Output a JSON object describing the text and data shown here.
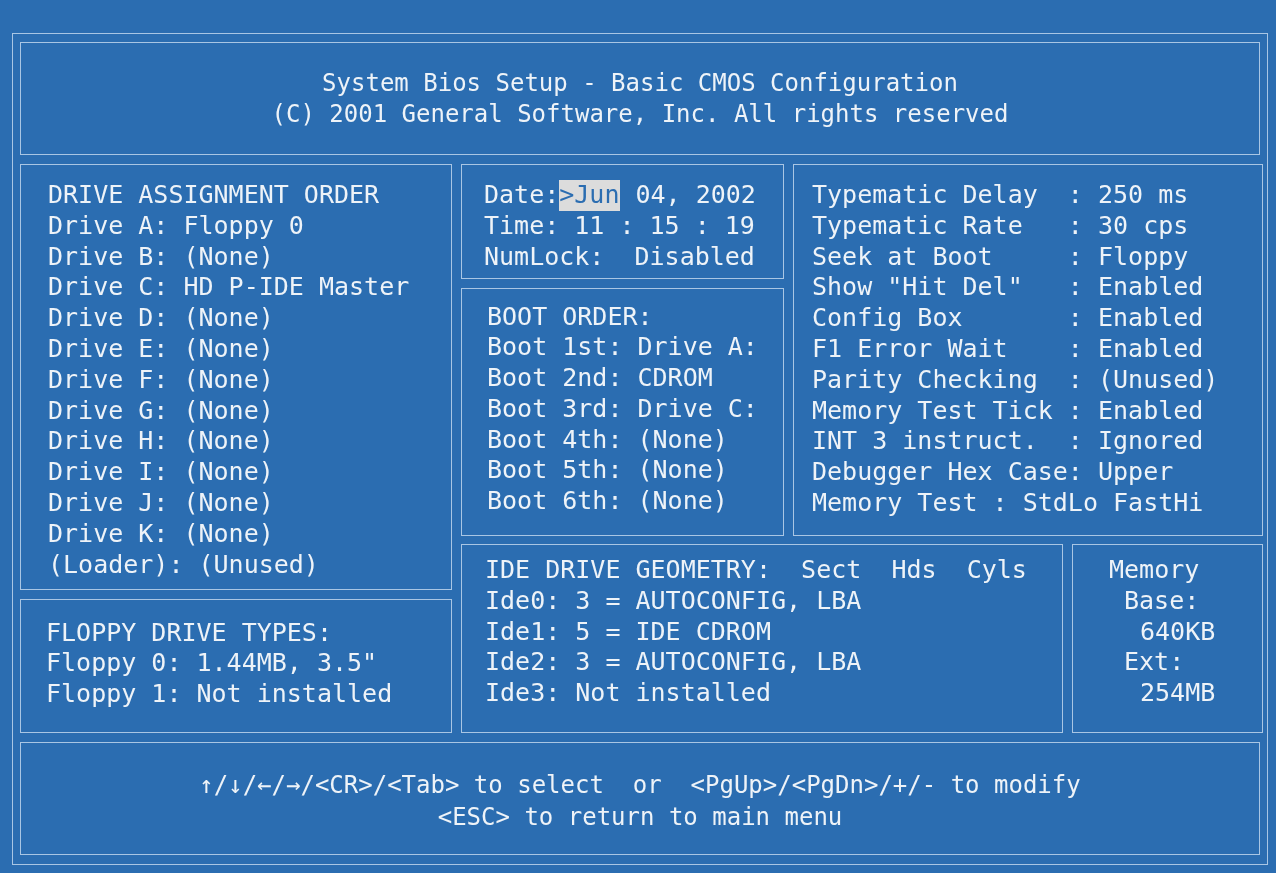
{
  "header": {
    "title": "System Bios Setup - Basic CMOS Configuration",
    "copyright": "(C) 2001 General Software, Inc. All rights reserved"
  },
  "drive_assignment": {
    "title": "DRIVE ASSIGNMENT ORDER",
    "lines": [
      "Drive A: Floppy 0",
      "Drive B: (None)",
      "Drive C: HD P-IDE Master",
      "Drive D: (None)",
      "Drive E: (None)",
      "Drive F: (None)",
      "Drive G: (None)",
      "Drive H: (None)",
      "Drive I: (None)",
      "Drive J: (None)",
      "Drive K: (None)",
      "(Loader): (Unused)"
    ]
  },
  "date_time": {
    "date_label": "Date:",
    "date_parts": [
      {
        "text": ">Jun",
        "selected": true
      },
      {
        "text": "04, 2002",
        "selected": false
      }
    ],
    "lines": [
      "Time: 11 : 15 : 19",
      "NumLock:  Disabled"
    ]
  },
  "boot_order": {
    "title": "BOOT ORDER:",
    "lines": [
      "Boot 1st: Drive A:",
      "Boot 2nd: CDROM",
      "Boot 3rd: Drive C:",
      "Boot 4th: (None)",
      "Boot 5th: (None)",
      "Boot 6th: (None)"
    ]
  },
  "settings": [
    "Typematic Delay  : 250 ms",
    "Typematic Rate   : 30 cps",
    "Seek at Boot     : Floppy",
    "Show \"Hit Del\"   : Enabled",
    "Config Box       : Enabled",
    "F1 Error Wait    : Enabled",
    "Parity Checking  : (Unused)",
    "Memory Test Tick : Enabled",
    "INT 3 instruct.  : Ignored",
    "Debugger Hex Case: Upper",
    "Memory Test : StdLo FastHi"
  ],
  "floppy_types": {
    "title": "FLOPPY DRIVE TYPES:",
    "lines": [
      "Floppy 0: 1.44MB, 3.5\"",
      "Floppy 1: Not installed"
    ]
  },
  "ide_geometry": {
    "title": "IDE DRIVE GEOMETRY:  Sect  Hds  Cyls",
    "lines": [
      "Ide0: 3 = AUTOCONFIG, LBA",
      "Ide1: 5 = IDE CDROM",
      "Ide2: 3 = AUTOCONFIG, LBA",
      "Ide3: Not installed"
    ]
  },
  "memory": [
    {
      "kind": "heading",
      "text": "Memory"
    },
    {
      "kind": "label",
      "text": "Base:"
    },
    {
      "kind": "value",
      "text": "640KB"
    },
    {
      "kind": "label",
      "text": "Ext:"
    },
    {
      "kind": "value",
      "text": "254MB"
    }
  ],
  "footer": [
    "↑/↓/←/→/<CR>/<Tab> to select  or  <PgUp>/<PgDn>/+/- to modify",
    "<ESC> to return to main menu"
  ]
}
